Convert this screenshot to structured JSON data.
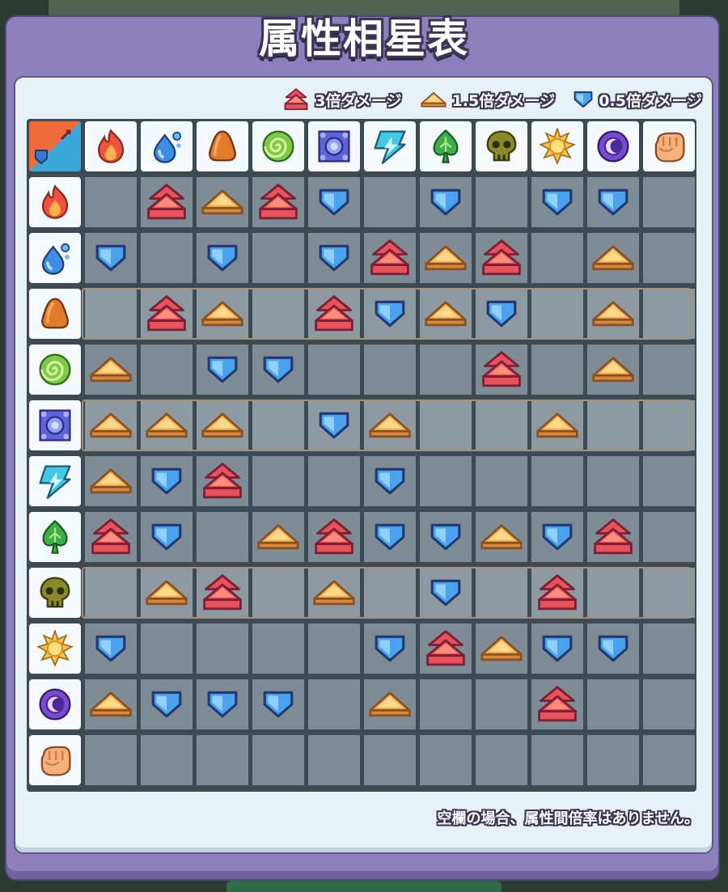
{
  "title": "属性相星表",
  "legend": [
    {
      "marker": "triple-arrow",
      "label": "3倍ダメージ"
    },
    {
      "marker": "single-arrow",
      "label": "1.5倍ダメージ"
    },
    {
      "marker": "shield-down",
      "label": "0.5倍ダメージ"
    }
  ],
  "note": "空欄の場合、属性間倍率はありません。",
  "elements": [
    "fire",
    "water",
    "earth",
    "wind",
    "arcane",
    "lightning",
    "nature",
    "poison",
    "light",
    "dark",
    "physical"
  ],
  "highlighted_rows": [
    2,
    4,
    7
  ],
  "matrix": [
    [
      "",
      "3",
      "1.5",
      "3",
      "0.5",
      "",
      "0.5",
      "",
      "0.5",
      "0.5",
      ""
    ],
    [
      "0.5",
      "",
      "0.5",
      "",
      "0.5",
      "3",
      "1.5",
      "3",
      "",
      "1.5",
      ""
    ],
    [
      "",
      "3",
      "1.5",
      "",
      "3",
      "0.5",
      "1.5",
      "0.5",
      "",
      "1.5",
      ""
    ],
    [
      "1.5",
      "",
      "0.5",
      "0.5",
      "",
      "",
      "",
      "3",
      "",
      "1.5",
      ""
    ],
    [
      "1.5",
      "1.5",
      "1.5",
      "",
      "0.5",
      "1.5",
      "",
      "",
      "1.5",
      "",
      ""
    ],
    [
      "1.5",
      "0.5",
      "3",
      "",
      "",
      "0.5",
      "",
      "",
      "",
      "",
      ""
    ],
    [
      "3",
      "0.5",
      "",
      "1.5",
      "3",
      "0.5",
      "0.5",
      "1.5",
      "0.5",
      "3",
      ""
    ],
    [
      "",
      "1.5",
      "3",
      "",
      "1.5",
      "",
      "0.5",
      "",
      "3",
      "",
      ""
    ],
    [
      "0.5",
      "",
      "",
      "",
      "",
      "0.5",
      "3",
      "1.5",
      "0.5",
      "0.5",
      ""
    ],
    [
      "1.5",
      "0.5",
      "0.5",
      "0.5",
      "",
      "1.5",
      "",
      "",
      "3",
      "",
      ""
    ],
    [
      "",
      "",
      "",
      "",
      "",
      "",
      "",
      "",
      "",
      "",
      ""
    ]
  ],
  "colors": {
    "triple": "#e9525a",
    "single": "#f4b65a",
    "half": "#4aa2ee",
    "cell": "#7e8c95",
    "panel": "#8d80bd"
  }
}
